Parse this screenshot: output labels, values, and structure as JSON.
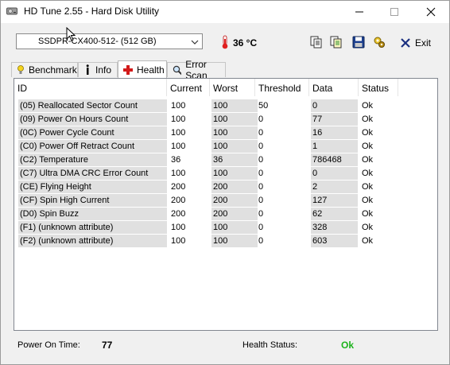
{
  "window": {
    "title": "HD Tune 2.55 - Hard Disk Utility"
  },
  "toolbar": {
    "drive_selected": "SSDPR-CX400-512- (512 GB)",
    "temperature": "36 °C",
    "exit_label": "Exit"
  },
  "tabs": [
    {
      "label": "Benchmark",
      "icon": "bulb-icon"
    },
    {
      "label": "Info",
      "icon": "info-icon"
    },
    {
      "label": "Health",
      "icon": "red-cross-icon",
      "active": true
    },
    {
      "label": "Error Scan",
      "icon": "magnifier-icon"
    }
  ],
  "table": {
    "headers": [
      "ID",
      "Current",
      "Worst",
      "Threshold",
      "Data",
      "Status"
    ],
    "rows": [
      [
        "(05) Reallocated Sector Count",
        "100",
        "100",
        "50",
        "0",
        "Ok"
      ],
      [
        "(09) Power On Hours Count",
        "100",
        "100",
        "0",
        "77",
        "Ok"
      ],
      [
        "(0C) Power Cycle Count",
        "100",
        "100",
        "0",
        "16",
        "Ok"
      ],
      [
        "(C0) Power Off Retract Count",
        "100",
        "100",
        "0",
        "1",
        "Ok"
      ],
      [
        "(C2) Temperature",
        "36",
        "36",
        "0",
        "786468",
        "Ok"
      ],
      [
        "(C7) Ultra DMA CRC Error Count",
        "100",
        "100",
        "0",
        "0",
        "Ok"
      ],
      [
        "(CE) Flying Height",
        "200",
        "200",
        "0",
        "2",
        "Ok"
      ],
      [
        "(CF) Spin High Current",
        "200",
        "200",
        "0",
        "127",
        "Ok"
      ],
      [
        "(D0) Spin Buzz",
        "200",
        "200",
        "0",
        "62",
        "Ok"
      ],
      [
        "(F1) (unknown attribute)",
        "100",
        "100",
        "0",
        "328",
        "Ok"
      ],
      [
        "(F2) (unknown attribute)",
        "100",
        "100",
        "0",
        "603",
        "Ok"
      ]
    ]
  },
  "status": {
    "power_on_label": "Power On Time:",
    "power_on_value": "77",
    "health_label": "Health Status:",
    "health_value": "Ok",
    "health_color": "#1db31d"
  }
}
